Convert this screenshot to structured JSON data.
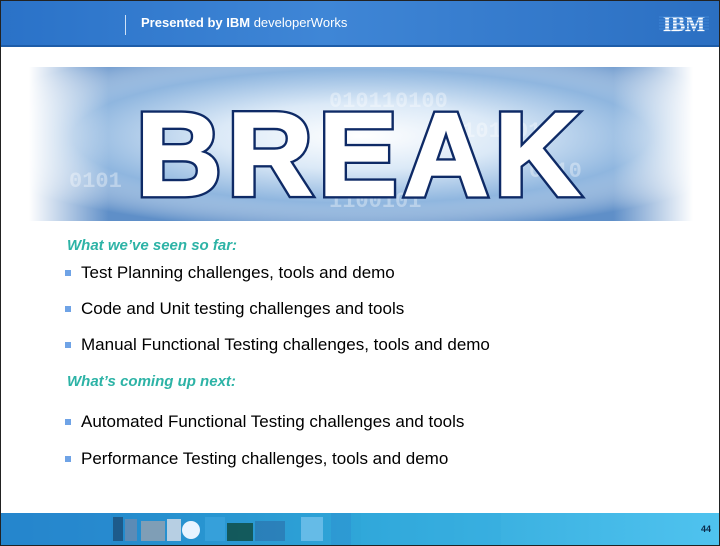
{
  "header": {
    "presented_bold": "Presented by IBM",
    "presented_rest": " developerWorks",
    "logo_text": "IBM"
  },
  "banner": {
    "title": "BREAK"
  },
  "sections": [
    {
      "heading": "What we’ve seen so far:",
      "items": [
        "Test Planning challenges, tools and demo",
        "Code and Unit testing challenges and tools",
        "Manual Functional Testing challenges, tools and demo"
      ]
    },
    {
      "heading": "What’s coming up next:",
      "items": [
        "Automated Functional Testing challenges and tools",
        "Performance Testing challenges, tools and demo"
      ]
    }
  ],
  "footer": {
    "page_number": "44"
  },
  "colors": {
    "header_blue": "#2a72c8",
    "heading_teal": "#2db3a6",
    "bullet_blue": "#6fa3e6"
  }
}
